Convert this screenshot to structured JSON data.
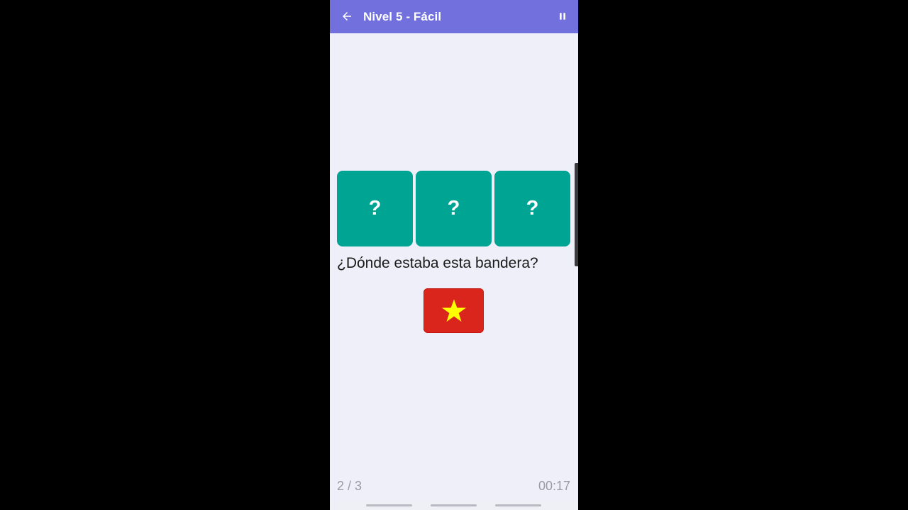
{
  "appbar": {
    "title": "Nivel 5 - Fácil",
    "back_icon": "arrow-left-icon",
    "pause_icon": "pause-icon",
    "color": "#7170dc"
  },
  "cards": [
    {
      "label": "?"
    },
    {
      "label": "?"
    },
    {
      "label": "?"
    }
  ],
  "card_color": "#00a493",
  "question": "¿Dónde estaba esta bandera?",
  "flag": {
    "icon": "vietnam-flag-icon",
    "background": "#da251d",
    "star_color": "#ffff00"
  },
  "footer": {
    "progress": "2 / 3",
    "timer": "00:17"
  }
}
